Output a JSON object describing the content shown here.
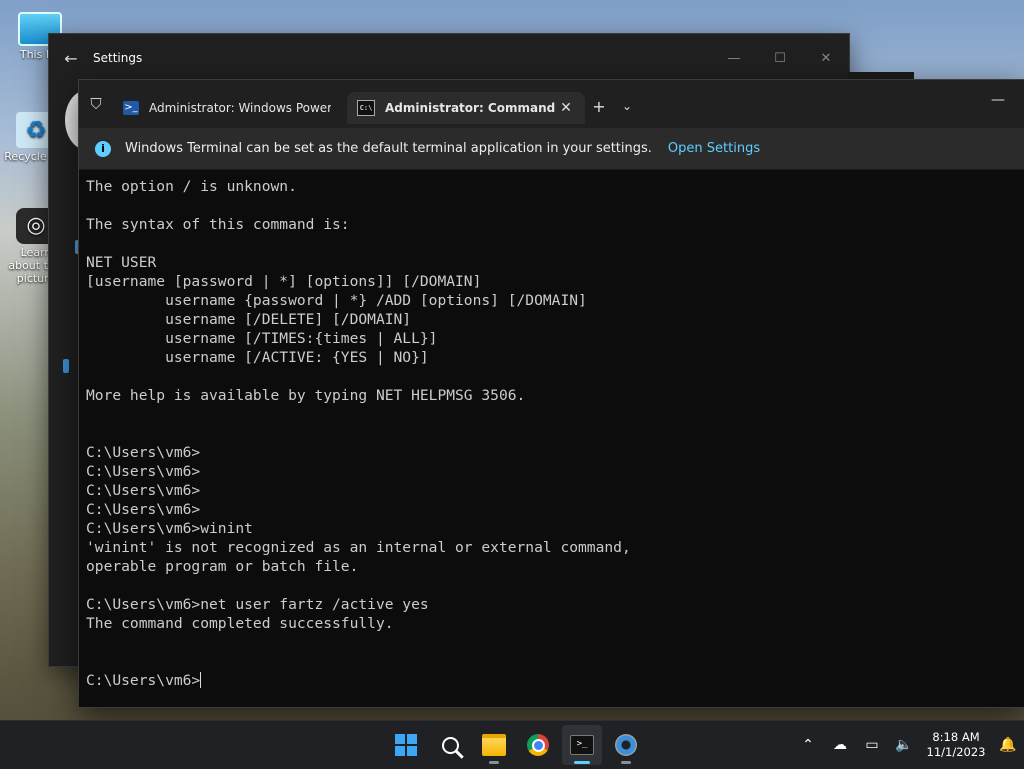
{
  "desktop": {
    "icons": [
      {
        "label": "This PC",
        "icon": "monitor-icon"
      },
      {
        "label": "Recycle Bin",
        "icon": "recycle-bin-icon"
      },
      {
        "label": "Learn about this picture",
        "icon": "camera-icon"
      }
    ]
  },
  "settings": {
    "title": "Settings",
    "back_icon": "←",
    "minimize": "—",
    "maximize": "☐",
    "close": "✕"
  },
  "terminal": {
    "tabs": [
      {
        "label": "Administrator: Windows PowerShell",
        "icon": "powershell-icon",
        "active": false
      },
      {
        "label": "Administrator: Command Prompt",
        "icon": "cmd-icon",
        "active": true
      }
    ],
    "tab_close": "✕",
    "new_tab": "+",
    "tab_menu": "⌄",
    "minimize": "—",
    "infobar": {
      "message": "Windows Terminal can be set as the default terminal application in your settings.",
      "link": "Open Settings"
    },
    "console_lines": [
      "The option / is unknown.",
      "",
      "The syntax of this command is:",
      "",
      "NET USER",
      "[username [password | *] [options]] [/DOMAIN]",
      "         username {password | *} /ADD [options] [/DOMAIN]",
      "         username [/DELETE] [/DOMAIN]",
      "         username [/TIMES:{times | ALL}]",
      "         username [/ACTIVE: {YES | NO}]",
      "",
      "More help is available by typing NET HELPMSG 3506.",
      "",
      "",
      "C:\\Users\\vm6>",
      "C:\\Users\\vm6>",
      "C:\\Users\\vm6>",
      "C:\\Users\\vm6>",
      "C:\\Users\\vm6>winint",
      "'winint' is not recognized as an internal or external command,",
      "operable program or batch file.",
      "",
      "C:\\Users\\vm6>net user fartz /active yes",
      "The command completed successfully.",
      "",
      ""
    ],
    "prompt": "C:\\Users\\vm6>"
  },
  "taskbar": {
    "apps": [
      "start-icon",
      "search-icon",
      "file-explorer-icon",
      "chrome-icon",
      "terminal-icon",
      "settings-icon"
    ],
    "tray": {
      "chevron": "⌃",
      "time": "8:18 AM",
      "date": "11/1/2023"
    }
  },
  "colors": {
    "accent": "#60cdff",
    "console_bg": "#0c0c0c",
    "console_fg": "#cccccc",
    "taskbar_bg": "#1f2125"
  }
}
